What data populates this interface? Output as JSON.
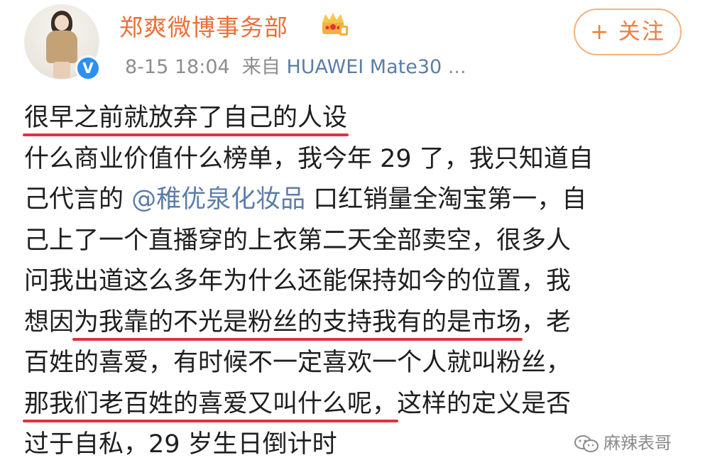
{
  "header": {
    "username": "郑爽微博事务部",
    "timestamp": "8-15 18:04",
    "source_prefix": "来自",
    "device": "HUAWEI Mate30",
    "more": "...",
    "follow_label": "+ 关注",
    "verified_badge": "V",
    "crown_icon": "crown-vip-icon",
    "accent_color": "#e8713a"
  },
  "post": {
    "lines": [
      "很早之前就放弃了自己的人设",
      "什么商业价值什么榜单，我今年 29 了，我只知道自",
      "己代言的",
      "@稚优泉化妆品",
      " 口红销量全淘宝第一，自",
      "己上了一个直播穿的上衣第二天全部卖空，很多人",
      "问我出道这么多年为什么还能保持如今的位置，我",
      "想因",
      "为我靠的不光是粉丝的支持我有的是市场",
      "，老",
      "百姓的喜爱，有时候不一定喜欢一个人就叫粉丝，",
      "那我们老百姓的喜爱又叫什么呢，",
      "这样的定义是否",
      "过于自私，29 岁生日倒计时"
    ],
    "underline_color": "#e0323f",
    "mention_color": "#5b7da8"
  },
  "watermark": {
    "text": "麻辣表哥",
    "icon": "wechat-icon"
  }
}
